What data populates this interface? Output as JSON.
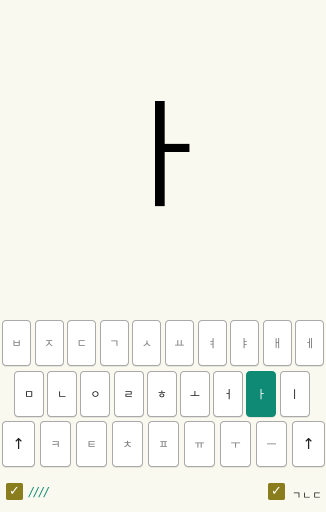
{
  "display": {
    "character": "ㅏ"
  },
  "keyboard": {
    "row1": [
      "ㅂ",
      "ㅈ",
      "ㄷ",
      "ㄱ",
      "ㅅ",
      "ㅛ",
      "ㅕ",
      "ㅑ",
      "ㅐ",
      "ㅔ"
    ],
    "row2": [
      "ㅁ",
      "ㄴ",
      "ㅇ",
      "ㄹ",
      "ㅎ",
      "ㅗ",
      "ㅓ",
      "ㅏ",
      "ㅣ"
    ],
    "row2_active_index": 7,
    "row3": [
      "↑",
      "ㅋ",
      "ㅌ",
      "ㅊ",
      "ㅍ",
      "ㅠ",
      "ㅜ",
      "ㅡ",
      "↑"
    ]
  },
  "bottom_bar": {
    "left_checkbox_checked": true,
    "left_label": "////",
    "right_checkbox_checked": true,
    "right_label": "ㄱㄴㄷ",
    "check_mark": "✓"
  },
  "colors": {
    "background": "#faf9ef",
    "active_key": "#0f8a75",
    "checkbox": "#8a7d1e"
  }
}
